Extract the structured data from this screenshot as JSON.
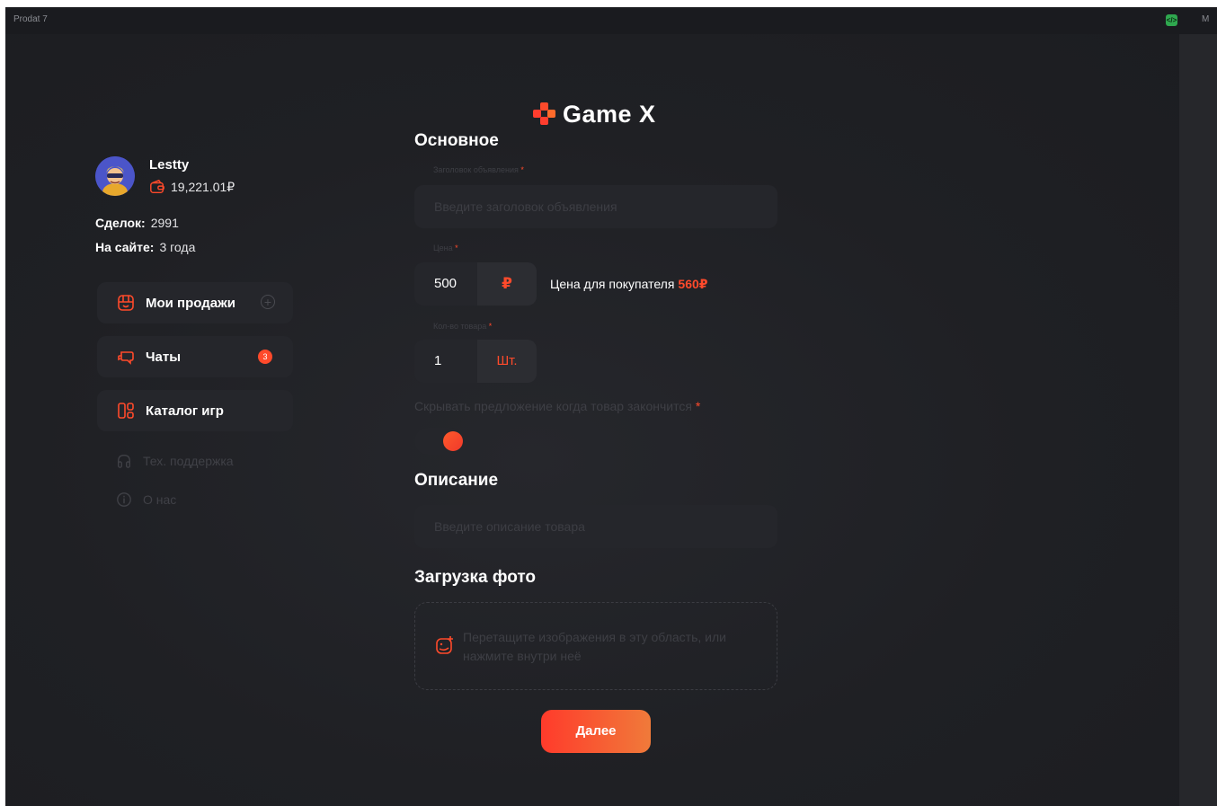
{
  "window": {
    "title": "Prodat 7",
    "right_text": "M"
  },
  "brand": {
    "name": "Game X"
  },
  "profile": {
    "username": "Lestty",
    "balance": "19,221.01₽",
    "stats": [
      {
        "label": "Сделок:",
        "value": "2991"
      },
      {
        "label": "На сайте:",
        "value": "3 года"
      }
    ]
  },
  "menu": [
    {
      "label": "Мои продажи",
      "icon": "bag-icon"
    },
    {
      "label": "Чаты",
      "icon": "chat-icon",
      "badge": "3"
    },
    {
      "label": "Каталог игр",
      "icon": "grid-icon"
    }
  ],
  "aux_menu": [
    {
      "label": "Тех. поддержка",
      "icon": "headphones-icon"
    },
    {
      "label": "О нас",
      "icon": "info-icon"
    }
  ],
  "form": {
    "main_title": "Основное",
    "title_field": {
      "label": "Заголовок объявления",
      "required": "*",
      "placeholder": "Введите заголовок объявления"
    },
    "price_field": {
      "label": "Цена",
      "required": "*",
      "value": "500",
      "currency": "₽"
    },
    "buyer_price": {
      "text": "Цена для покупателя",
      "amount": "560₽"
    },
    "qty_field": {
      "label": "Кол-во товара",
      "required": "*",
      "value": "1",
      "unit": "Шт."
    },
    "hide_offer": {
      "label": "Скрывать предложение когда товар закончится",
      "required": "*",
      "enabled": true
    },
    "description_title": "Описание",
    "description_placeholder": "Введите описание товара",
    "upload_title": "Загрузка фото",
    "upload_hint": "Перетащите изображения в эту область, или нажмите внутри неё",
    "next_button": "Далее"
  },
  "colors": {
    "accent": "#ff4a2b",
    "background": "#1e1f23",
    "panel": "#25262b"
  }
}
